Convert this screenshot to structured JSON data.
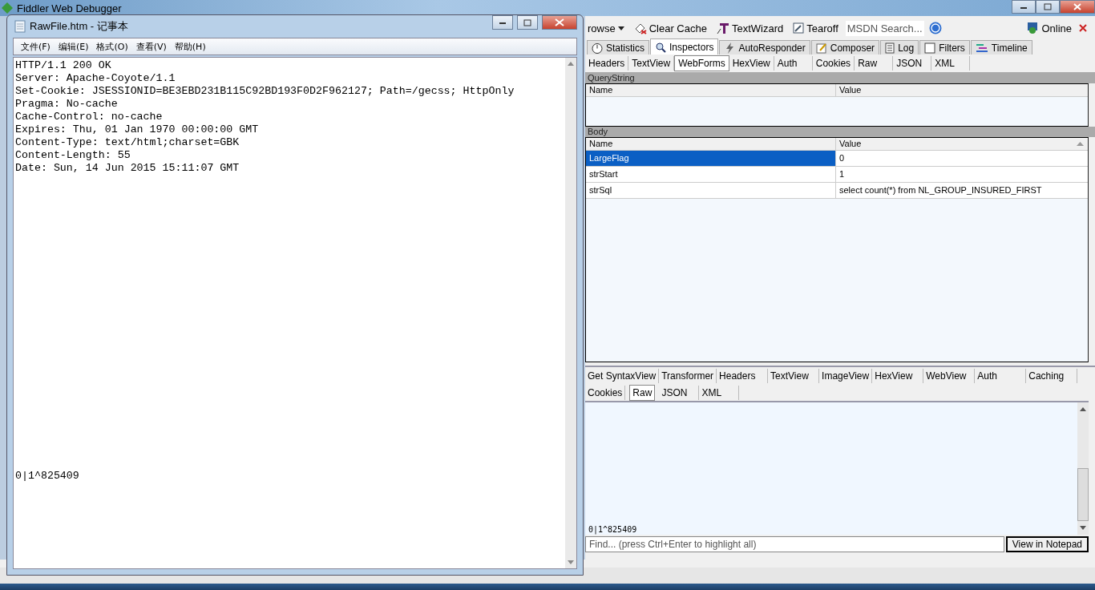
{
  "fiddler": {
    "title": "Fiddler Web Debugger",
    "toolbar": [
      {
        "kind": "dropdown",
        "label": "rowse"
      },
      {
        "kind": "clear",
        "label": "Clear Cache"
      },
      {
        "kind": "wizard",
        "label": "TextWizard"
      },
      {
        "kind": "tearoff",
        "label": "Tearoff"
      }
    ],
    "search": {
      "placeholder": "MSDN Search..."
    },
    "online": "Online",
    "tabs": [
      {
        "kind": "statistics",
        "label": "Statistics",
        "selected": false
      },
      {
        "kind": "inspectors",
        "label": "Inspectors",
        "selected": true
      },
      {
        "kind": "autoresponder",
        "label": "AutoResponder",
        "selected": false
      },
      {
        "kind": "composer",
        "label": "Composer",
        "selected": false
      },
      {
        "kind": "log",
        "label": "Log",
        "selected": false
      },
      {
        "kind": "filters",
        "label": "Filters",
        "selected": false
      },
      {
        "kind": "timeline",
        "label": "Timeline",
        "selected": false
      }
    ],
    "request_tabs": [
      {
        "label": "Headers",
        "selected": false
      },
      {
        "label": "TextView",
        "selected": false
      },
      {
        "label": "WebForms",
        "selected": true
      },
      {
        "label": "HexView",
        "selected": false
      },
      {
        "label": "Auth",
        "selected": false
      },
      {
        "label": "Cookies",
        "selected": false
      },
      {
        "label": "Raw",
        "selected": false
      },
      {
        "label": "JSON",
        "selected": false
      },
      {
        "label": "XML",
        "selected": false
      }
    ],
    "querystring": {
      "title": "QueryString",
      "columns": [
        "Name",
        "Value"
      ]
    },
    "body": {
      "title": "Body",
      "columns": [
        "Name",
        "Value"
      ],
      "rows": [
        {
          "name": "LargeFlag",
          "value": "0",
          "selected": true
        },
        {
          "name": "strStart",
          "value": "1",
          "selected": false
        },
        {
          "name": "strSql",
          "value": "select count(*) from NL_GROUP_INSURED_FIRST",
          "selected": false
        }
      ]
    },
    "response_tabs": [
      [
        {
          "label": "Get SyntaxView",
          "selected": false
        },
        {
          "label": "Transformer",
          "selected": false
        },
        {
          "label": "Headers",
          "selected": false
        },
        {
          "label": "TextView",
          "selected": false
        },
        {
          "label": "ImageView",
          "selected": false
        },
        {
          "label": "HexView",
          "selected": false
        },
        {
          "label": "WebView",
          "selected": false
        },
        {
          "label": "Auth",
          "selected": false
        },
        {
          "label": "Caching",
          "selected": false
        }
      ],
      [
        {
          "label": "Cookies",
          "selected": false
        },
        {
          "label": "Raw",
          "selected": true
        },
        {
          "label": "JSON",
          "selected": false
        },
        {
          "label": "XML",
          "selected": false
        }
      ]
    ],
    "response_text": "0|1^825409",
    "find": {
      "placeholder": "Find... (press Ctrl+Enter to highlight all)"
    },
    "view_button": "View in Notepad"
  },
  "notepad": {
    "title": "RawFile.htm - 记事本",
    "menu": [
      "文件(F)",
      "编辑(E)",
      "格式(O)",
      "查看(V)",
      "帮助(H)"
    ],
    "lines": [
      "HTTP/1.1 200 OK",
      "Server: Apache-Coyote/1.1",
      "Set-Cookie: JSESSIONID=BE3EBD231B115C92BD193F0D2F962127; Path=/gecss; HttpOnly",
      "Pragma: No-cache",
      "Cache-Control: no-cache",
      "Expires: Thu, 01 Jan 1970 00:00:00 GMT",
      "Content-Type: text/html;charset=GBK",
      "Content-Length: 55",
      "Date: Sun, 14 Jun 2015 15:11:07 GMT"
    ],
    "last_line": "0|1^825409"
  }
}
